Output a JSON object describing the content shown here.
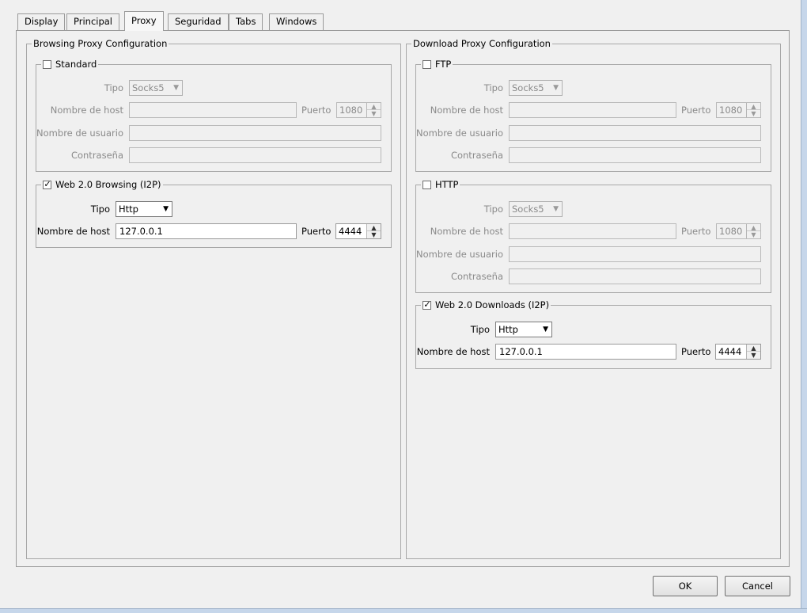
{
  "tabs": [
    "Display",
    "Principal",
    "Proxy",
    "Seguridad",
    "Tabs",
    "Windows"
  ],
  "active_tab": "Proxy",
  "browsing": {
    "title": "Browsing Proxy Configuration",
    "standard": {
      "label": "Standard",
      "checked": false,
      "tipo_label": "Tipo",
      "tipo_value": "Socks5",
      "host_label": "Nombre de host",
      "host_value": "",
      "puerto_label": "Puerto",
      "puerto_value": "1080",
      "user_label": "Nombre de usuario",
      "user_value": "",
      "pass_label": "Contraseña",
      "pass_value": ""
    },
    "web20": {
      "label": "Web 2.0 Browsing (I2P)",
      "checked": true,
      "tipo_label": "Tipo",
      "tipo_value": "Http",
      "host_label": "Nombre de host",
      "host_value": "127.0.0.1",
      "puerto_label": "Puerto",
      "puerto_value": "4444"
    }
  },
  "download": {
    "title": "Download Proxy Configuration",
    "ftp": {
      "label": "FTP",
      "checked": false,
      "tipo_label": "Tipo",
      "tipo_value": "Socks5",
      "host_label": "Nombre de host",
      "host_value": "",
      "puerto_label": "Puerto",
      "puerto_value": "1080",
      "user_label": "Nombre de usuario",
      "user_value": "",
      "pass_label": "Contraseña",
      "pass_value": ""
    },
    "http": {
      "label": "HTTP",
      "checked": false,
      "tipo_label": "Tipo",
      "tipo_value": "Socks5",
      "host_label": "Nombre de host",
      "host_value": "",
      "puerto_label": "Puerto",
      "puerto_value": "1080",
      "user_label": "Nombre de usuario",
      "user_value": "",
      "pass_label": "Contraseña",
      "pass_value": ""
    },
    "web20": {
      "label": "Web 2.0 Downloads (I2P)",
      "checked": true,
      "tipo_label": "Tipo",
      "tipo_value": "Http",
      "host_label": "Nombre de host",
      "host_value": "127.0.0.1",
      "puerto_label": "Puerto",
      "puerto_value": "4444"
    }
  },
  "buttons": {
    "ok": "OK",
    "cancel": "Cancel"
  },
  "colors": {
    "window_frame": "#c6d6ea",
    "dialog_bg": "#f0f0f0",
    "disabled_text": "#8a8a8a"
  }
}
